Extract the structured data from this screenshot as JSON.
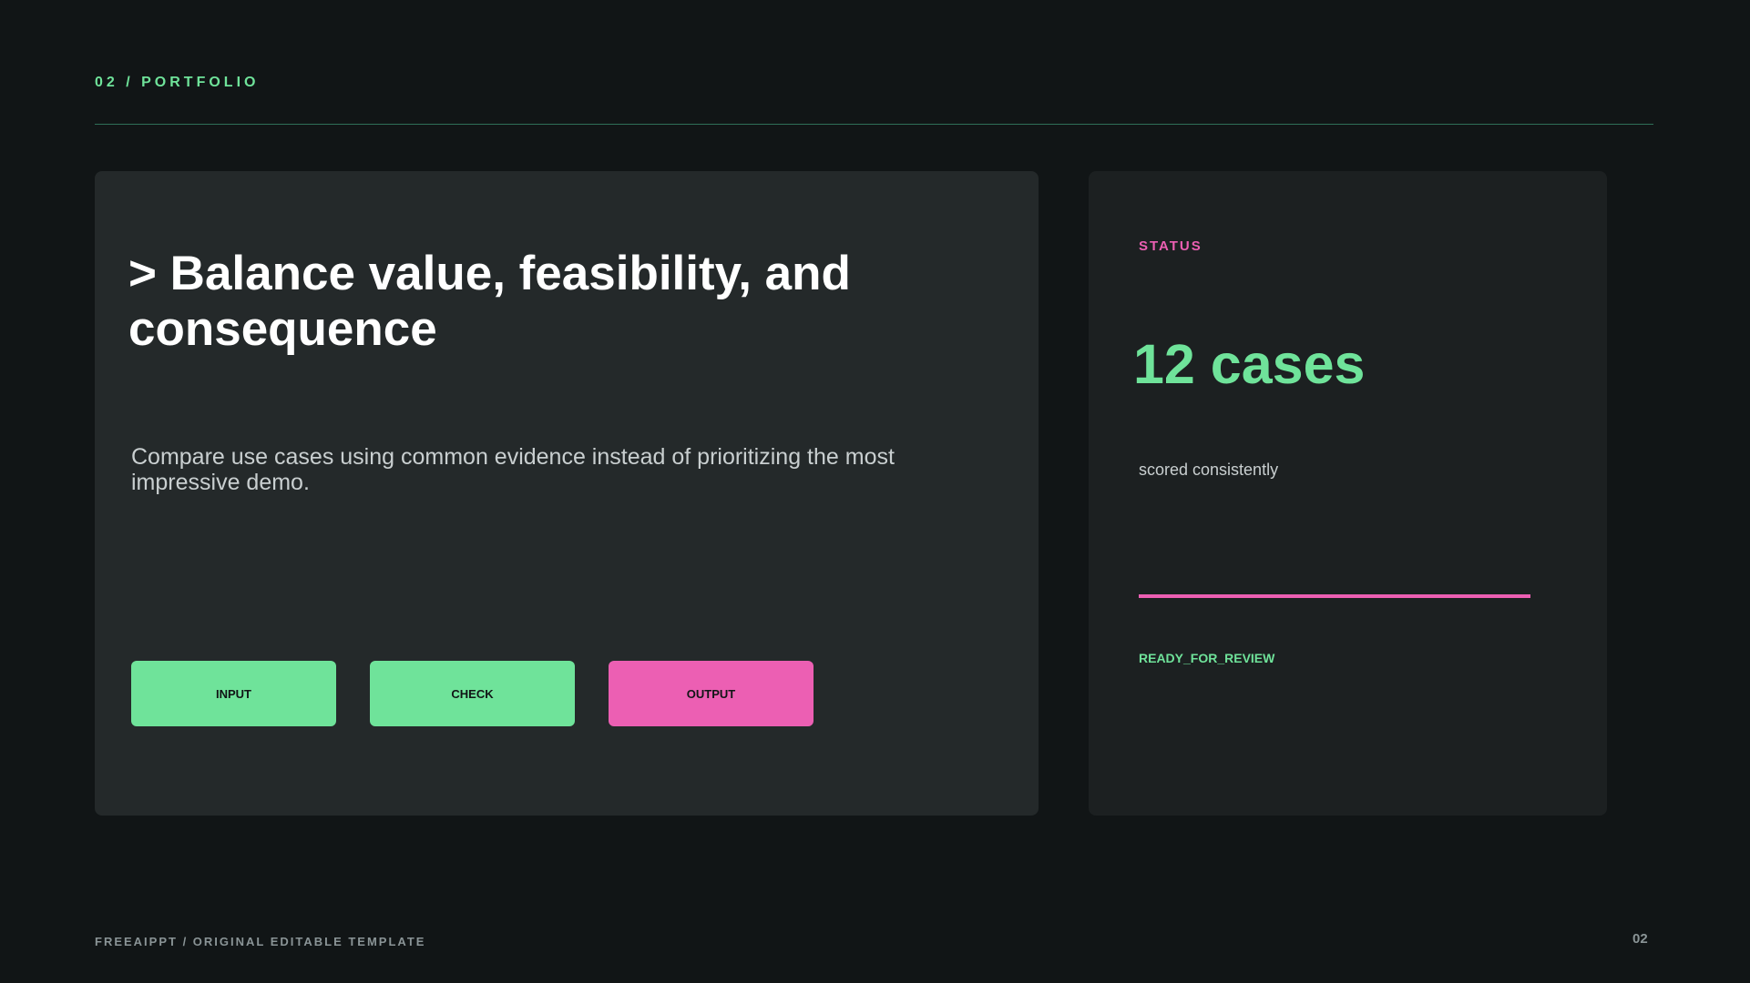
{
  "header": {
    "section_label": "02 / PORTFOLIO"
  },
  "main": {
    "headline": "> Balance value, feasibility, and consequence",
    "body": "Compare use cases using common evidence instead of prioritizing the most impressive demo.",
    "steps": [
      {
        "label": "INPUT",
        "color": "#6fe39a"
      },
      {
        "label": "CHECK",
        "color": "#6fe39a"
      },
      {
        "label": "OUTPUT",
        "color": "#ec5fb3"
      }
    ]
  },
  "status": {
    "label": "STATUS",
    "metric": "12 cases",
    "caption": "scored consistently",
    "progress": 1.0,
    "state": "READY_FOR_REVIEW"
  },
  "footer": {
    "left": "FREEAIPPT / ORIGINAL EDITABLE TEMPLATE",
    "page": "02"
  },
  "colors": {
    "background": "#111516",
    "accent_green": "#6fe39a",
    "accent_pink": "#ec5fb3",
    "card": "#24292a",
    "status_card": "#1c2021"
  }
}
